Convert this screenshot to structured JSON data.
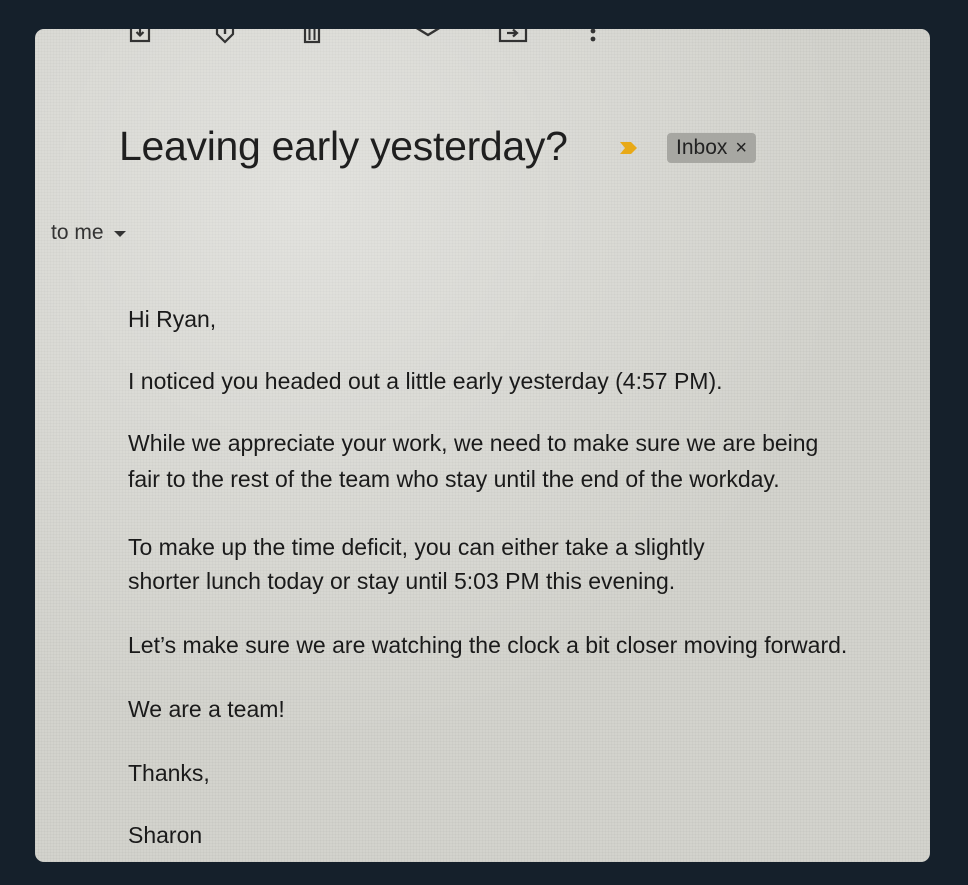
{
  "toolbar": {
    "icons": [
      "archive-icon",
      "report-spam-icon",
      "delete-icon",
      "mark-unread-icon",
      "move-to-icon",
      "more-options-icon"
    ]
  },
  "email": {
    "subject": "Leaving early yesterday?",
    "label": "Inbox",
    "label_remove": "×",
    "recipient": "to me",
    "body": {
      "greeting": "Hi Ryan,",
      "p1": "I noticed you headed out a little early yesterday (4:57 PM).",
      "p2_line1": "While we appreciate your work, we need to make sure we are being",
      "p2_line2": "fair to the rest of the team who stay until the end of the workday.",
      "p3_line1": "To make up the time deficit, you can either take a slightly",
      "p3_line2": "shorter lunch today or stay until 5:03 PM this evening.",
      "p4": "Let’s make sure we are watching the clock a bit closer moving forward.",
      "p5": "We are a team!",
      "closing": "Thanks,",
      "signature": "Sharon"
    }
  },
  "colors": {
    "background": "#15202b",
    "screen": "#d3d3cd",
    "importance_marker": "#e8a917",
    "label_chip": "#a7a7a2"
  }
}
